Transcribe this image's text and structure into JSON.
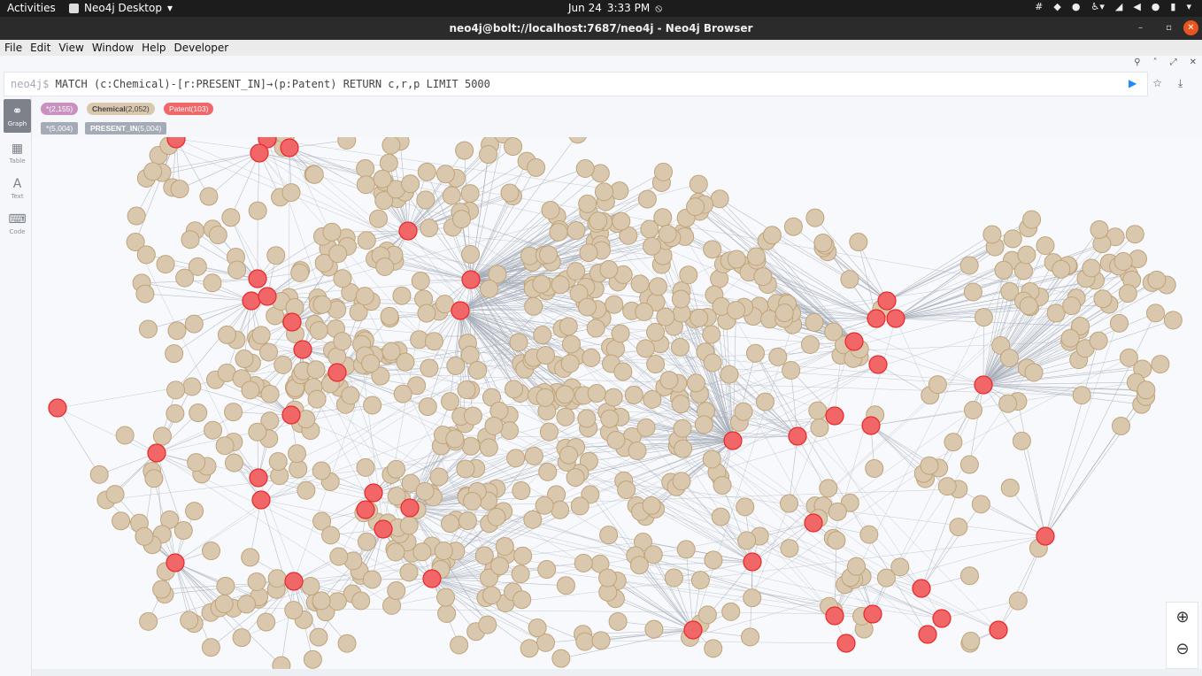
{
  "system": {
    "activities": "Activities",
    "app_name": "Neo4j Desktop",
    "date": "Jun 24",
    "time": "3:33 PM"
  },
  "window": {
    "title": "neo4j@bolt://localhost:7687/neo4j - Neo4j Browser"
  },
  "menu": [
    "File",
    "Edit",
    "View",
    "Window",
    "Help",
    "Developer"
  ],
  "editor": {
    "prompt": "neo4j$",
    "query": "MATCH (c:Chemical)-[r:PRESENT_IN]→(p:Patent) RETURN c,r,p LIMIT 5000"
  },
  "sidebar": [
    {
      "label": "Graph",
      "icon": "graph-icon",
      "active": true
    },
    {
      "label": "Table",
      "icon": "table-icon"
    },
    {
      "label": "Text",
      "icon": "text-icon"
    },
    {
      "label": "Code",
      "icon": "code-icon"
    }
  ],
  "legend": {
    "nodes_all": {
      "name": "*",
      "count": "(2,155)",
      "color": "#c990c0"
    },
    "chemical": {
      "name": "Chemical",
      "count": "(2,052)",
      "color": "#d9c8ae"
    },
    "patent": {
      "name": "Patent",
      "count": "(103)",
      "color": "#f16667"
    },
    "rels_all": {
      "name": "*",
      "count": "(5,004)"
    },
    "present_in": {
      "name": "PRESENT_IN",
      "count": "(5,004)"
    }
  },
  "colors": {
    "chemical_fill": "#d9c8ae",
    "chemical_stroke": "#c0a378",
    "patent_fill": "#f16667",
    "patent_stroke": "#eb2728",
    "edge": "#a5abb6"
  },
  "zoom": {
    "in": "zoom-in-icon",
    "out": "zoom-out-icon"
  }
}
